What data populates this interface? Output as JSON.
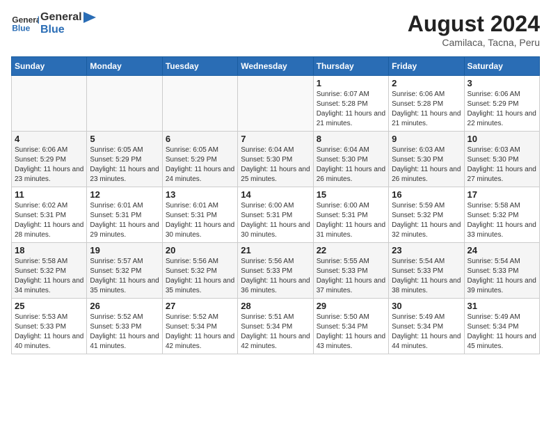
{
  "header": {
    "logo_general": "General",
    "logo_blue": "Blue",
    "month_title": "August 2024",
    "location": "Camilaca, Tacna, Peru"
  },
  "days_of_week": [
    "Sunday",
    "Monday",
    "Tuesday",
    "Wednesday",
    "Thursday",
    "Friday",
    "Saturday"
  ],
  "weeks": [
    [
      {
        "day": "",
        "info": ""
      },
      {
        "day": "",
        "info": ""
      },
      {
        "day": "",
        "info": ""
      },
      {
        "day": "",
        "info": ""
      },
      {
        "day": "1",
        "info": "Sunrise: 6:07 AM\nSunset: 5:28 PM\nDaylight: 11 hours and 21 minutes."
      },
      {
        "day": "2",
        "info": "Sunrise: 6:06 AM\nSunset: 5:28 PM\nDaylight: 11 hours and 21 minutes."
      },
      {
        "day": "3",
        "info": "Sunrise: 6:06 AM\nSunset: 5:29 PM\nDaylight: 11 hours and 22 minutes."
      }
    ],
    [
      {
        "day": "4",
        "info": "Sunrise: 6:06 AM\nSunset: 5:29 PM\nDaylight: 11 hours and 23 minutes."
      },
      {
        "day": "5",
        "info": "Sunrise: 6:05 AM\nSunset: 5:29 PM\nDaylight: 11 hours and 23 minutes."
      },
      {
        "day": "6",
        "info": "Sunrise: 6:05 AM\nSunset: 5:29 PM\nDaylight: 11 hours and 24 minutes."
      },
      {
        "day": "7",
        "info": "Sunrise: 6:04 AM\nSunset: 5:30 PM\nDaylight: 11 hours and 25 minutes."
      },
      {
        "day": "8",
        "info": "Sunrise: 6:04 AM\nSunset: 5:30 PM\nDaylight: 11 hours and 26 minutes."
      },
      {
        "day": "9",
        "info": "Sunrise: 6:03 AM\nSunset: 5:30 PM\nDaylight: 11 hours and 26 minutes."
      },
      {
        "day": "10",
        "info": "Sunrise: 6:03 AM\nSunset: 5:30 PM\nDaylight: 11 hours and 27 minutes."
      }
    ],
    [
      {
        "day": "11",
        "info": "Sunrise: 6:02 AM\nSunset: 5:31 PM\nDaylight: 11 hours and 28 minutes."
      },
      {
        "day": "12",
        "info": "Sunrise: 6:01 AM\nSunset: 5:31 PM\nDaylight: 11 hours and 29 minutes."
      },
      {
        "day": "13",
        "info": "Sunrise: 6:01 AM\nSunset: 5:31 PM\nDaylight: 11 hours and 30 minutes."
      },
      {
        "day": "14",
        "info": "Sunrise: 6:00 AM\nSunset: 5:31 PM\nDaylight: 11 hours and 30 minutes."
      },
      {
        "day": "15",
        "info": "Sunrise: 6:00 AM\nSunset: 5:31 PM\nDaylight: 11 hours and 31 minutes."
      },
      {
        "day": "16",
        "info": "Sunrise: 5:59 AM\nSunset: 5:32 PM\nDaylight: 11 hours and 32 minutes."
      },
      {
        "day": "17",
        "info": "Sunrise: 5:58 AM\nSunset: 5:32 PM\nDaylight: 11 hours and 33 minutes."
      }
    ],
    [
      {
        "day": "18",
        "info": "Sunrise: 5:58 AM\nSunset: 5:32 PM\nDaylight: 11 hours and 34 minutes."
      },
      {
        "day": "19",
        "info": "Sunrise: 5:57 AM\nSunset: 5:32 PM\nDaylight: 11 hours and 35 minutes."
      },
      {
        "day": "20",
        "info": "Sunrise: 5:56 AM\nSunset: 5:32 PM\nDaylight: 11 hours and 35 minutes."
      },
      {
        "day": "21",
        "info": "Sunrise: 5:56 AM\nSunset: 5:33 PM\nDaylight: 11 hours and 36 minutes."
      },
      {
        "day": "22",
        "info": "Sunrise: 5:55 AM\nSunset: 5:33 PM\nDaylight: 11 hours and 37 minutes."
      },
      {
        "day": "23",
        "info": "Sunrise: 5:54 AM\nSunset: 5:33 PM\nDaylight: 11 hours and 38 minutes."
      },
      {
        "day": "24",
        "info": "Sunrise: 5:54 AM\nSunset: 5:33 PM\nDaylight: 11 hours and 39 minutes."
      }
    ],
    [
      {
        "day": "25",
        "info": "Sunrise: 5:53 AM\nSunset: 5:33 PM\nDaylight: 11 hours and 40 minutes."
      },
      {
        "day": "26",
        "info": "Sunrise: 5:52 AM\nSunset: 5:33 PM\nDaylight: 11 hours and 41 minutes."
      },
      {
        "day": "27",
        "info": "Sunrise: 5:52 AM\nSunset: 5:34 PM\nDaylight: 11 hours and 42 minutes."
      },
      {
        "day": "28",
        "info": "Sunrise: 5:51 AM\nSunset: 5:34 PM\nDaylight: 11 hours and 42 minutes."
      },
      {
        "day": "29",
        "info": "Sunrise: 5:50 AM\nSunset: 5:34 PM\nDaylight: 11 hours and 43 minutes."
      },
      {
        "day": "30",
        "info": "Sunrise: 5:49 AM\nSunset: 5:34 PM\nDaylight: 11 hours and 44 minutes."
      },
      {
        "day": "31",
        "info": "Sunrise: 5:49 AM\nSunset: 5:34 PM\nDaylight: 11 hours and 45 minutes."
      }
    ]
  ]
}
